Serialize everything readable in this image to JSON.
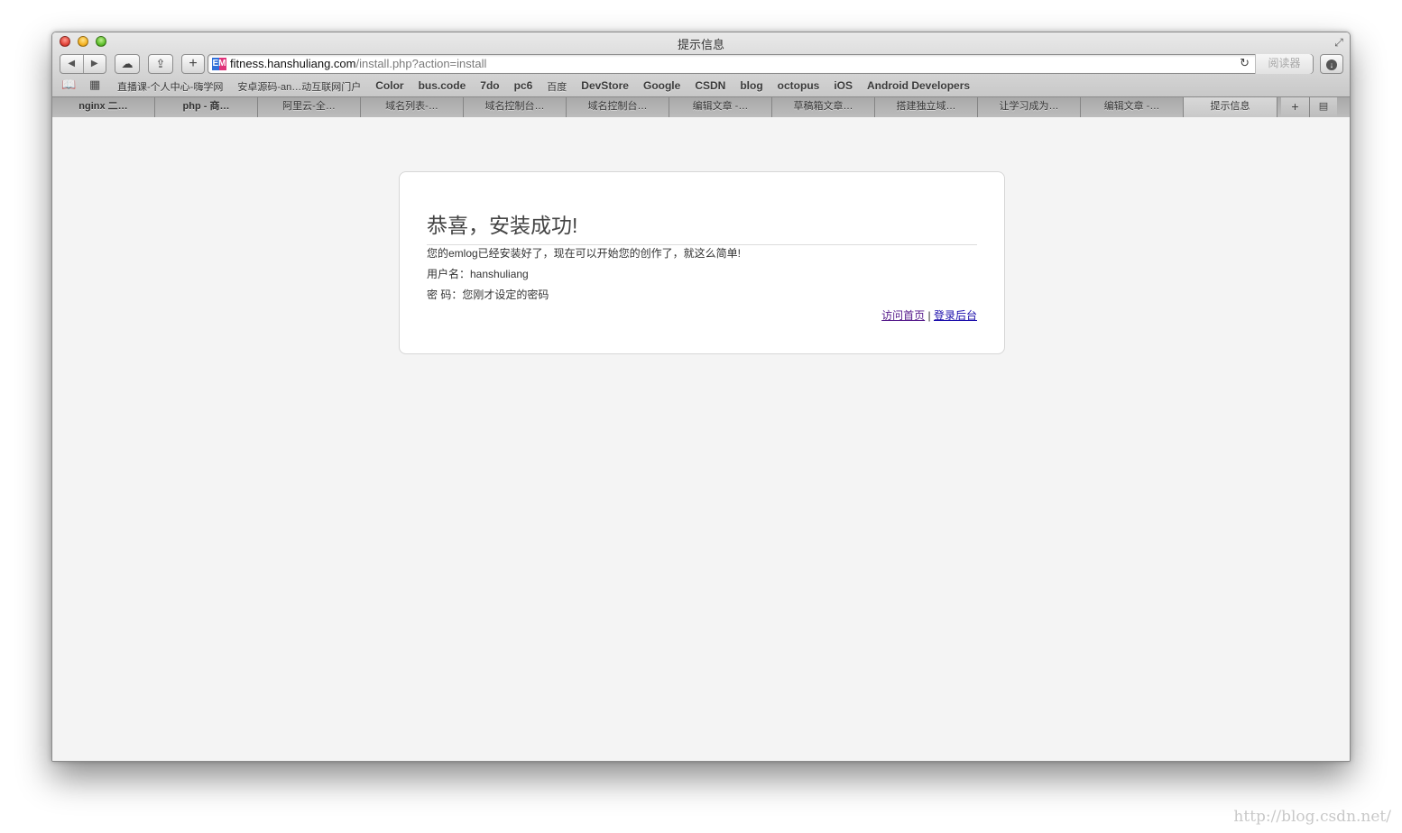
{
  "window": {
    "title": "提示信息"
  },
  "toolbar": {
    "back_icon": "◀",
    "forward_icon": "▶",
    "icloud_icon": "☁",
    "share_icon": "⇪",
    "add_icon": "+",
    "favicon_text": "EM",
    "url_host": "fitness.hanshuliang.com",
    "url_path": "/install.php?action=install",
    "reload_icon": "↻",
    "reader_label": "阅读器",
    "download_icon": "↓"
  },
  "bookmarks": {
    "book_icon": "📖",
    "grid_icon": "▦",
    "items": [
      "直播课-个人中心-嗨学网",
      "安卓源码-an…动互联网门户",
      "Color",
      "bus.code",
      "7do",
      "pc6",
      "百度",
      "DevStore",
      "Google",
      "CSDN",
      "blog",
      "octopus",
      "iOS",
      "Android Developers"
    ]
  },
  "tabs": {
    "items": [
      "nginx 二…",
      "php - 商…",
      "阿里云-全…",
      "域名列表-…",
      "域名控制台…",
      "域名控制台…",
      "编辑文章 -…",
      "草稿箱文章…",
      "搭建独立域…",
      "让学习成为…",
      "编辑文章 -…",
      "提示信息"
    ],
    "plus_icon": "+",
    "list_icon": "▤"
  },
  "card": {
    "title": "恭喜，安装成功!",
    "line1": "您的emlog已经安装好了，现在可以开始您的创作了，就这么简单!",
    "line2": "用户名：hanshuliang",
    "line3": "密 码：您刚才设定的密码",
    "link_home": "访问首页",
    "separator": "|",
    "link_admin": "登录后台"
  },
  "watermark": "http://blog.csdn.net/"
}
